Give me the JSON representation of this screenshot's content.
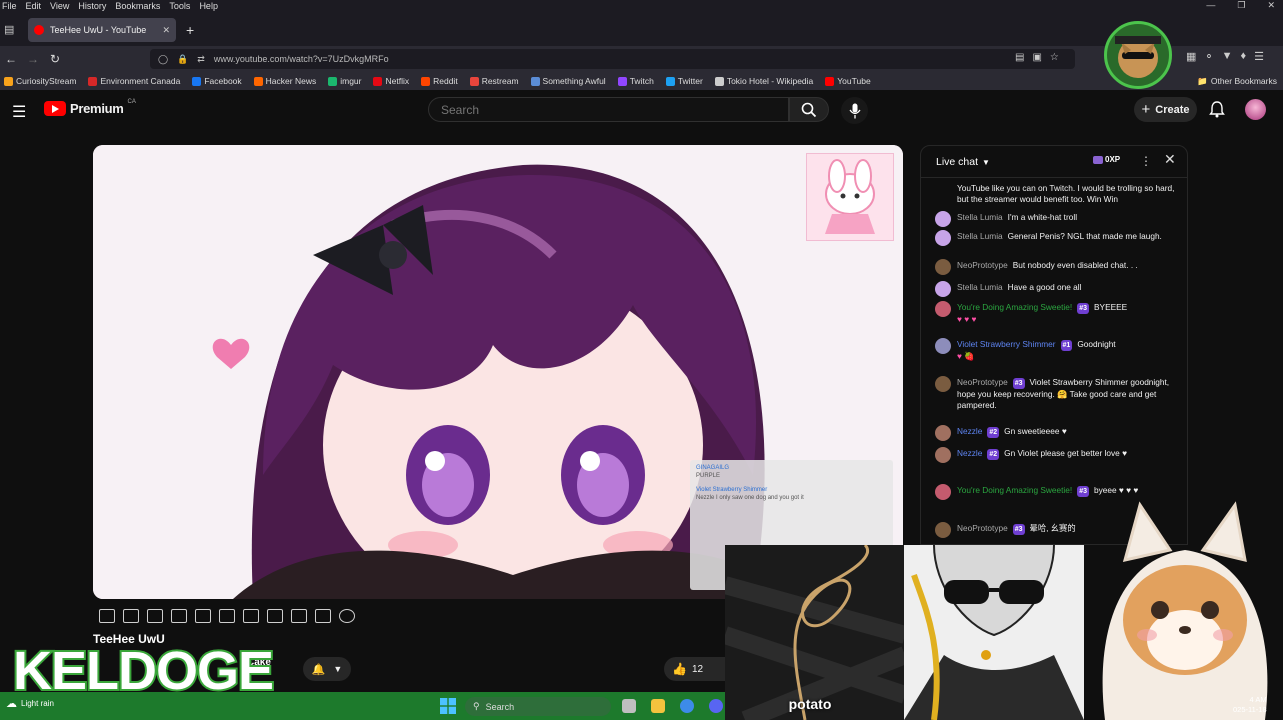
{
  "browser": {
    "menu": [
      "File",
      "Edit",
      "View",
      "History",
      "Bookmarks",
      "Tools",
      "Help"
    ],
    "tab_title": "TeeHee UwU - YouTube",
    "url": "www.youtube.com/watch?v=7UzDvkgMRFo",
    "bookmarks": [
      {
        "label": "CuriosityStream",
        "color": "#f7a21b"
      },
      {
        "label": "Environment Canada",
        "color": "#d62828"
      },
      {
        "label": "Facebook",
        "color": "#1877f2"
      },
      {
        "label": "Hacker News",
        "color": "#ff6600"
      },
      {
        "label": "imgur",
        "color": "#1bb76e"
      },
      {
        "label": "Netflix",
        "color": "#e50914"
      },
      {
        "label": "Reddit",
        "color": "#ff4500"
      },
      {
        "label": "Restream",
        "color": "#e8453c"
      },
      {
        "label": "Something Awful",
        "color": "#5b8dd6"
      },
      {
        "label": "Twitch",
        "color": "#9146ff"
      },
      {
        "label": "Twitter",
        "color": "#1da1f2"
      },
      {
        "label": "Tokio Hotel - Wikipedia",
        "color": "#cccccc"
      },
      {
        "label": "YouTube",
        "color": "#ff0000"
      }
    ],
    "other_bookmarks": "Other Bookmarks"
  },
  "youtube": {
    "logo_text": "Premium",
    "region": "CA",
    "search_placeholder": "Search",
    "create_label": "Create",
    "video_title": "TeeHee UwU",
    "channel_suffix": "Cake",
    "like_count": "12",
    "brand_color": "#ff0000"
  },
  "chat": {
    "title": "Live chat",
    "xp_label": "0XP",
    "messages": [
      {
        "author": "",
        "type": "none",
        "badge": "",
        "text": "YouTube like you can on Twitch. I would be trolling so hard, but the streamer would benefit too. Win Win",
        "avatar": "#b58fd6"
      },
      {
        "author": "Stella Lumia",
        "type": "normal",
        "badge": "",
        "text": "I'm a white-hat troll",
        "avatar": "#c7a4e8"
      },
      {
        "author": "Stella Lumia",
        "type": "normal",
        "badge": "",
        "text": "General Penis? NGL that made me laugh.",
        "avatar": "#c7a4e8"
      },
      {
        "author": "NeoPrototype",
        "type": "normal",
        "badge": "",
        "text": "But nobody even disabled chat. . .",
        "avatar": "#7a5c40"
      },
      {
        "author": "Stella Lumia",
        "type": "normal",
        "badge": "",
        "text": "Have a good one all",
        "avatar": "#c7a4e8"
      },
      {
        "author": "You're Doing Amazing Sweetie!",
        "type": "member",
        "badge": "#3",
        "text": "BYEEEE",
        "avatar": "#c45b6e",
        "emoji": "♥ ♥ ♥"
      },
      {
        "author": "Violet Strawberry Shimmer",
        "type": "mod",
        "badge": "#1",
        "text": "Goodnight",
        "avatar": "#8d8dbb",
        "emoji": "♥ 🍓"
      },
      {
        "author": "NeoPrototype",
        "type": "normal",
        "badge": "#3",
        "text": "Violet Strawberry Shimmer goodnight, hope you keep recovering. 🤗 Take good care and get pampered.",
        "avatar": "#7a5c40"
      },
      {
        "author": "Nezzle",
        "type": "mod",
        "badge": "#2",
        "text": "Gn sweetieeee ♥",
        "avatar": "#a07060"
      },
      {
        "author": "Nezzle",
        "type": "mod",
        "badge": "#2",
        "text": "Gn Violet please get better love ♥",
        "avatar": "#a07060"
      },
      {
        "author": "You're Doing Amazing Sweetie!",
        "type": "member",
        "badge": "#3",
        "text": "byeee ♥ ♥ ♥",
        "avatar": "#c45b6e"
      },
      {
        "author": "NeoPrototype",
        "type": "normal",
        "badge": "#3",
        "text": "晕哈, 幺赛的",
        "avatar": "#7a5c40"
      }
    ]
  },
  "player_overlay": {
    "lines": [
      {
        "name": "GINAGAILG",
        "text": "PURPLE"
      },
      {
        "name": "Violet Strawberry Shimmer",
        "text": "Nezzle I only saw one dog and you got it"
      }
    ]
  },
  "overlays": {
    "watermark": "KELDOGE",
    "caption": "potato",
    "watermark_color": "#3aa63a"
  },
  "taskbar": {
    "weather": "Light rain",
    "search": "Search",
    "time": "4 AM",
    "date": "025-11-18"
  }
}
